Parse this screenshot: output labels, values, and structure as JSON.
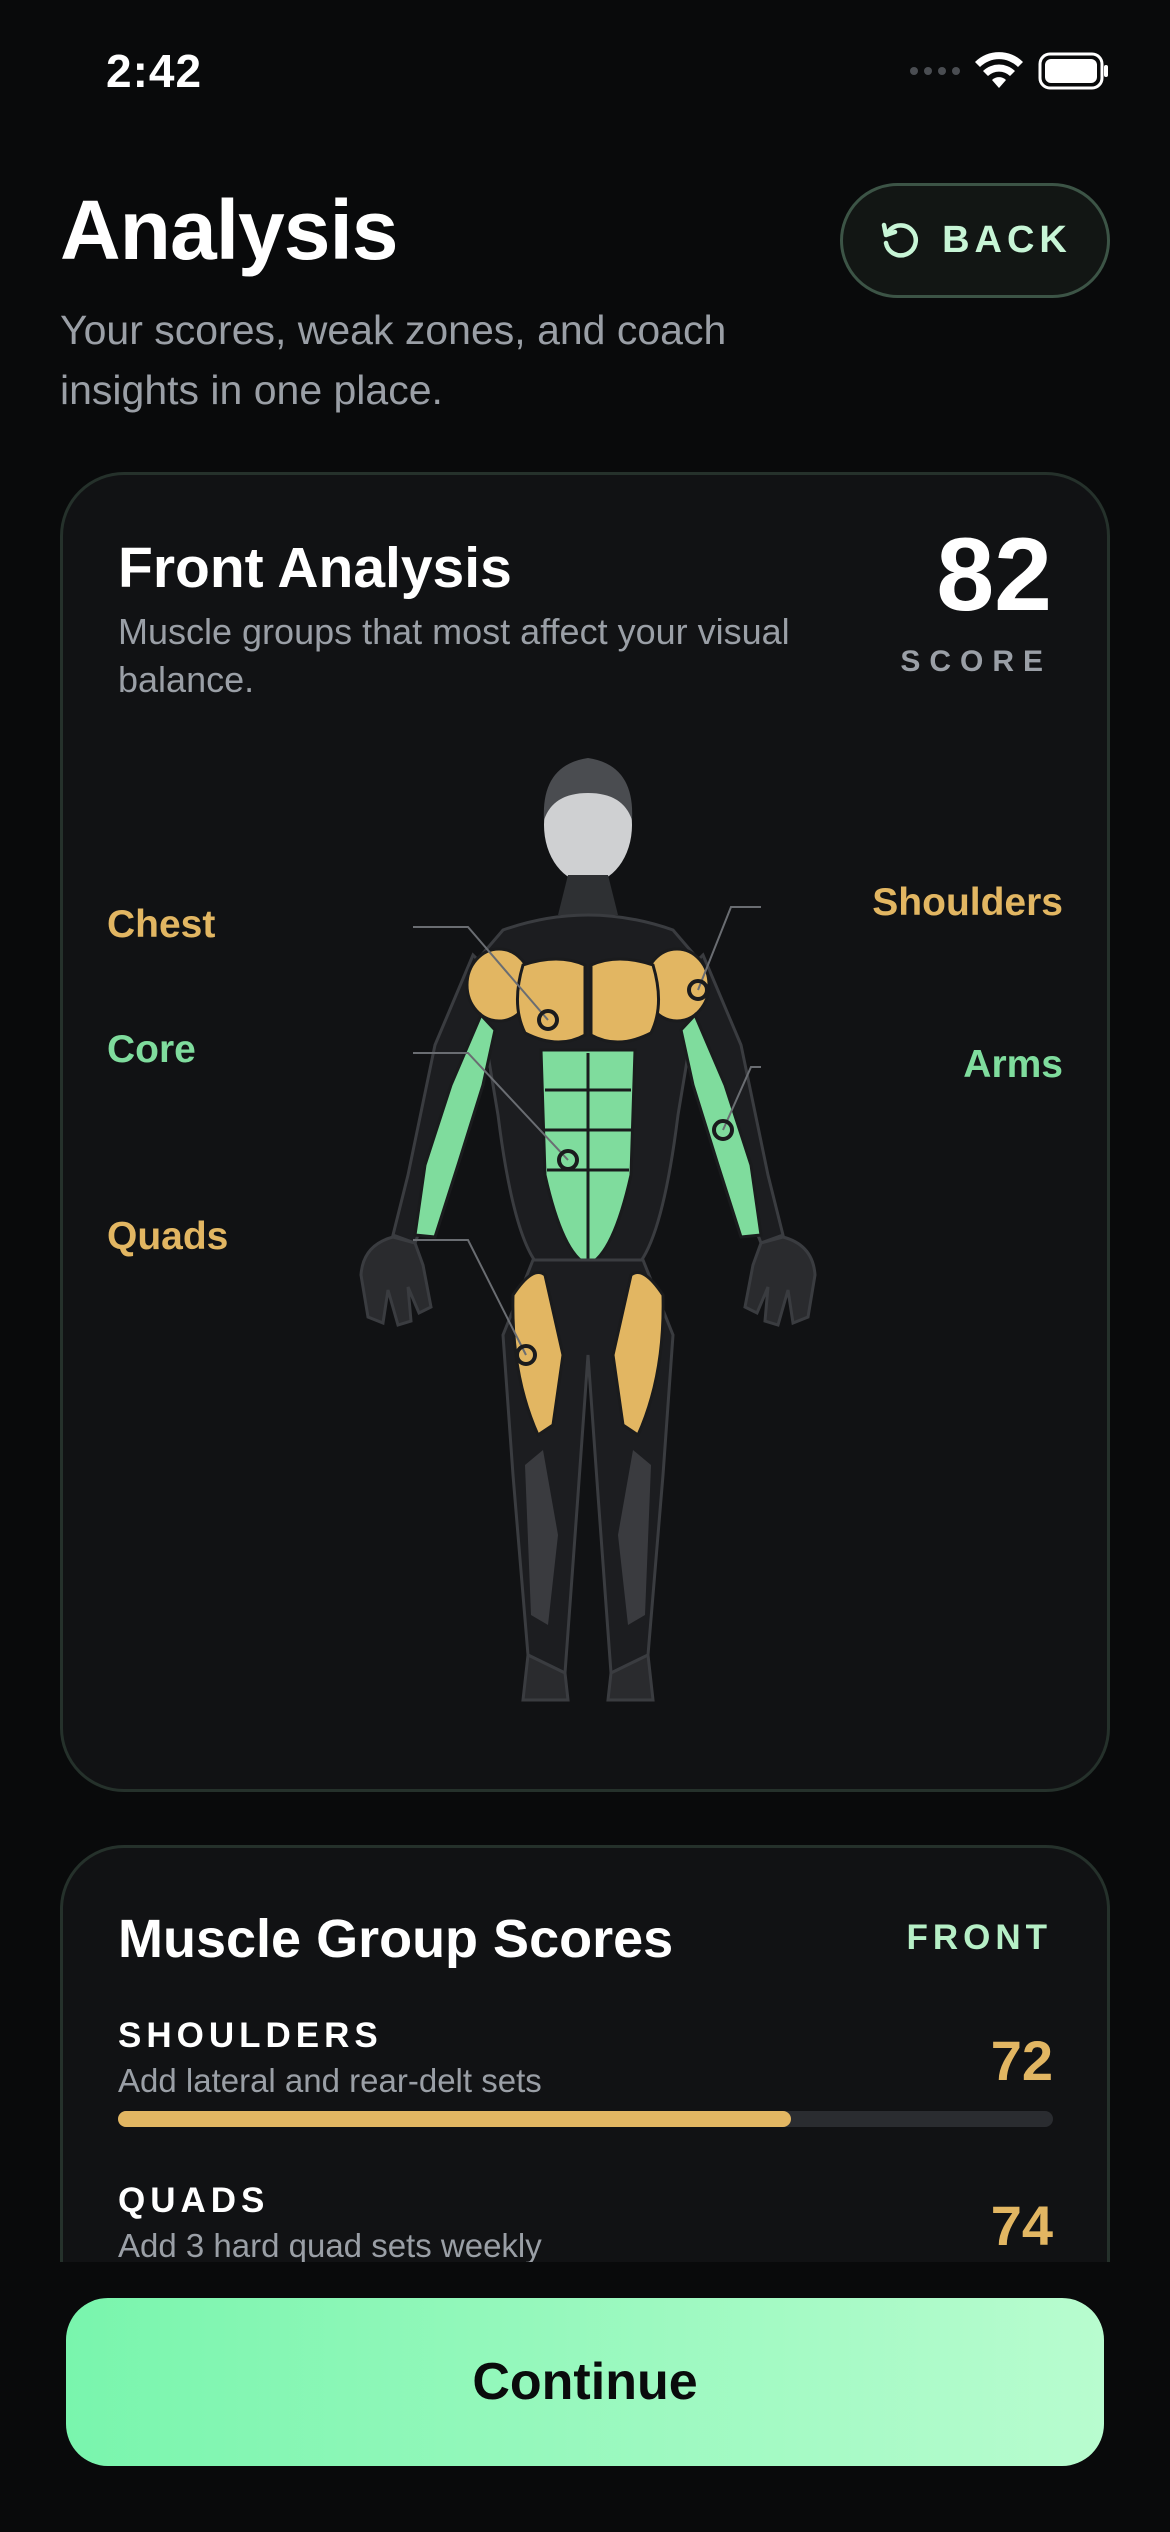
{
  "status": {
    "time": "2:42"
  },
  "header": {
    "title": "Analysis",
    "subtitle": "Your scores, weak zones, and coach insights in one place.",
    "back_label": "BACK"
  },
  "front_card": {
    "title": "Front Analysis",
    "description": "Muscle groups that most affect your visual balance.",
    "score": "82",
    "score_label": "SCORE",
    "zones": {
      "chest": "Chest",
      "core": "Core",
      "quads": "Quads",
      "shoulders": "Shoulders",
      "arms": "Arms"
    },
    "zone_colors": {
      "weak": "#e2b662",
      "strong": "#7fdc9d"
    }
  },
  "scores_card": {
    "title": "Muscle Group Scores",
    "view": "FRONT",
    "rows": [
      {
        "name": "SHOULDERS",
        "tip": "Add lateral and rear-delt sets",
        "score": "72",
        "fill": 0.72
      },
      {
        "name": "QUADS",
        "tip": "Add 3 hard quad sets weekly",
        "score": "74",
        "fill": 0.74
      }
    ]
  },
  "footer": {
    "continue_label": "Continue"
  }
}
